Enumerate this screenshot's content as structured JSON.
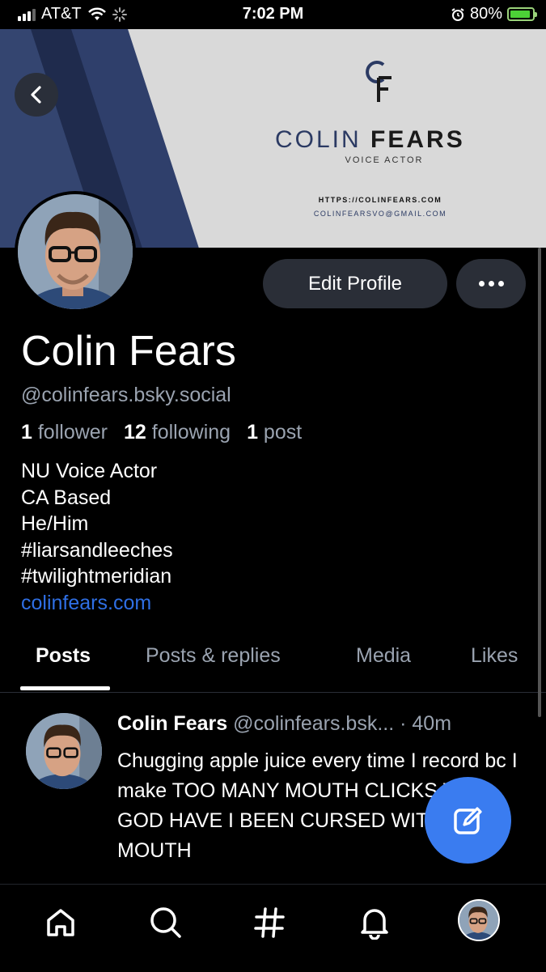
{
  "status_bar": {
    "carrier": "AT&T",
    "time": "7:02 PM",
    "battery": "80%"
  },
  "banner": {
    "logo_letters": "CF",
    "brand_first": "COLIN",
    "brand_last": "FEARS",
    "brand_subtitle": "VOICE ACTOR",
    "url": "HTTPS://COLINFEARS.COM",
    "email": "COLINFEARSVO@GMAIL.COM"
  },
  "profile": {
    "display_name": "Colin Fears",
    "handle": "@colinfears.bsky.social",
    "followers_count": "1",
    "followers_label": "follower",
    "following_count": "12",
    "following_label": "following",
    "posts_count": "1",
    "posts_label": "post",
    "bio_lines": [
      "NU Voice Actor",
      "CA Based",
      "He/Him",
      "#liarsandleeches",
      "#twilightmeridian"
    ],
    "website": "colinfears.com",
    "edit_label": "Edit Profile"
  },
  "tabs": [
    {
      "label": "Posts",
      "active": true
    },
    {
      "label": "Posts & replies",
      "active": false
    },
    {
      "label": "Media",
      "active": false
    },
    {
      "label": "Likes",
      "active": false
    }
  ],
  "post": {
    "author": "Colin Fears",
    "handle": "@colinfears.bsk...",
    "time": "· 40m",
    "text": "Chugging apple juice every time I record bc I make TOO MANY MOUTH CLICKS WHY GOD HAVE I BEEN CURSED WITH THIS MOUTH"
  },
  "colors": {
    "accent": "#3a7cf0",
    "link": "#2f6fe4",
    "button_bg": "#2a2e37",
    "muted_text": "#9aa3b0"
  },
  "icons": {
    "nav": [
      "home-icon",
      "search-icon",
      "feeds-hash-icon",
      "notifications-bell-icon",
      "profile-avatar"
    ],
    "fab": "compose-icon",
    "back": "back-chevron-icon",
    "more": "more-dots-icon"
  }
}
